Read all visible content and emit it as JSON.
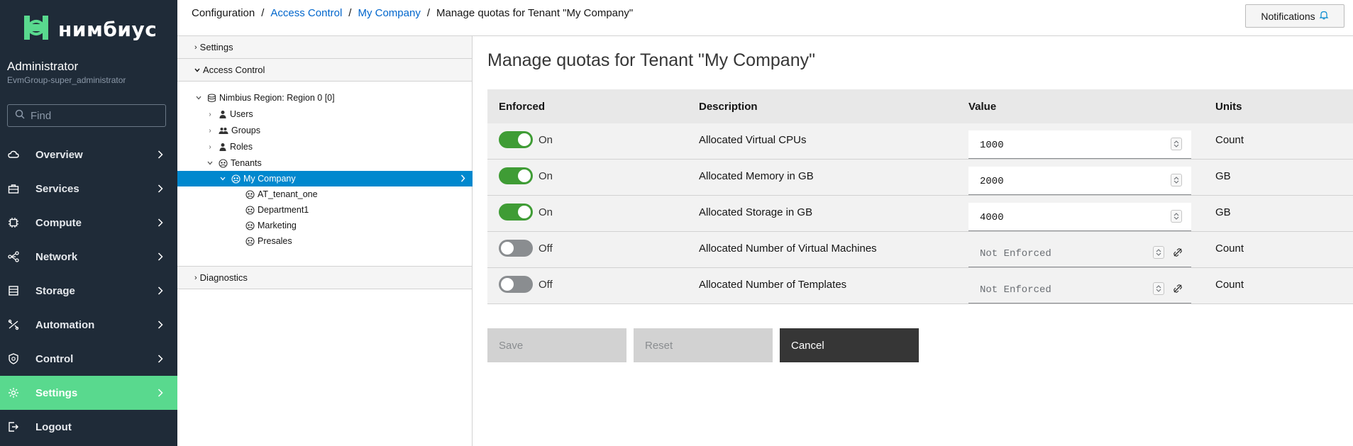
{
  "brand": {
    "name": "нимбиус"
  },
  "user": {
    "name": "Administrator",
    "group": "EvmGroup-super_administrator"
  },
  "search": {
    "placeholder": "Find"
  },
  "nav": {
    "items": [
      {
        "label": "Overview",
        "icon": "cloud-icon"
      },
      {
        "label": "Services",
        "icon": "briefcase-icon"
      },
      {
        "label": "Compute",
        "icon": "cpu-icon"
      },
      {
        "label": "Network",
        "icon": "network-icon"
      },
      {
        "label": "Storage",
        "icon": "database-icon"
      },
      {
        "label": "Automation",
        "icon": "automation-icon"
      },
      {
        "label": "Control",
        "icon": "shield-icon"
      },
      {
        "label": "Settings",
        "icon": "gear-icon"
      },
      {
        "label": "Logout",
        "icon": "logout-icon"
      }
    ],
    "active": "Settings"
  },
  "breadcrumb": {
    "root": "Configuration",
    "level1": "Access Control",
    "level2": "My Company",
    "current": "Manage quotas for Tenant \"My Company\""
  },
  "notifications": {
    "label": "Notifications"
  },
  "accordion": {
    "settings": "Settings",
    "access_control": "Access Control",
    "diagnostics": "Diagnostics"
  },
  "tree": {
    "region": "Nimbius Region: Region 0 [0]",
    "users": "Users",
    "groups": "Groups",
    "roles": "Roles",
    "tenants": "Tenants",
    "my_company": "My Company",
    "children": [
      "AT_tenant_one",
      "Department1",
      "Marketing",
      "Presales"
    ]
  },
  "page": {
    "title": "Manage quotas for Tenant \"My Company\""
  },
  "table": {
    "headers": {
      "enforced": "Enforced",
      "description": "Description",
      "value": "Value",
      "units": "Units"
    },
    "rows": [
      {
        "enforced": true,
        "state": "On",
        "description": "Allocated Virtual CPUs",
        "value": "1000",
        "units": "Count"
      },
      {
        "enforced": true,
        "state": "On",
        "description": "Allocated Memory in GB",
        "value": "2000",
        "units": "GB"
      },
      {
        "enforced": true,
        "state": "On",
        "description": "Allocated Storage in GB",
        "value": "4000",
        "units": "GB"
      },
      {
        "enforced": false,
        "state": "Off",
        "description": "Allocated Number of Virtual Machines",
        "placeholder": "Not Enforced",
        "units": "Count"
      },
      {
        "enforced": false,
        "state": "Off",
        "description": "Allocated Number of Templates",
        "placeholder": "Not Enforced",
        "units": "Count"
      }
    ]
  },
  "buttons": {
    "save": "Save",
    "reset": "Reset",
    "cancel": "Cancel"
  },
  "colors": {
    "sidebar": "#1f2b38",
    "active_nav": "#59d98e",
    "selected_tree": "#0088ce",
    "toggle_on": "#3f9c35",
    "link": "#0066cc"
  }
}
